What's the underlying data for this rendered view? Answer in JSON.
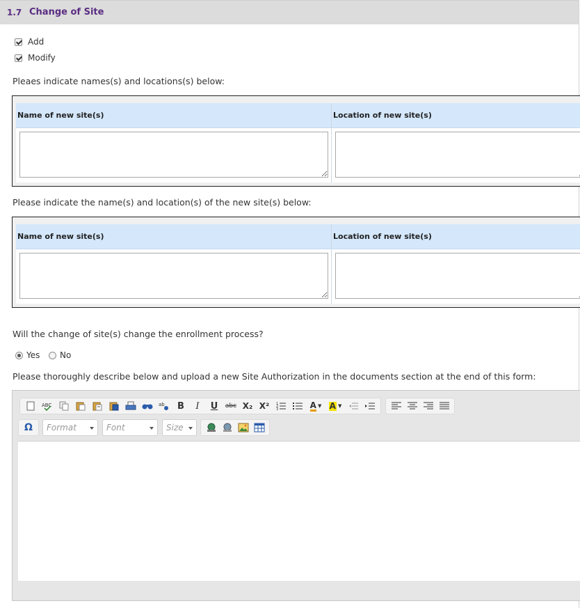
{
  "section": {
    "number": "1.7",
    "title": "Change of Site"
  },
  "checkboxes": [
    {
      "label": "Add",
      "checked": true
    },
    {
      "label": "Modify",
      "checked": true
    }
  ],
  "prompts": {
    "names_locations": "Pleaes indicate names(s) and locations(s) below:",
    "new_sites": "Please indicate the name(s) and location(s) of the new site(s) below:",
    "enrollment": "Will the change of site(s) change the enrollment process?",
    "describe": "Please thoroughly describe below and upload a new Site Authorization in the documents section at the end of this form:"
  },
  "table1": {
    "col1": "Name of new site(s)",
    "col2": "Location of new site(s)"
  },
  "table2": {
    "col1": "Name of new site(s)",
    "col2": "Location of new site(s)"
  },
  "enrollment_radio": {
    "yes": "Yes",
    "no": "No",
    "selected": "Yes"
  },
  "editor": {
    "combos": {
      "format": "Format",
      "font": "Font",
      "size": "Size"
    },
    "buttons": {
      "bold": "B",
      "italic": "I",
      "underline": "U",
      "strike": "abc",
      "subscript": "X₂",
      "superscript": "X²",
      "omega": "Ω",
      "text_color": "A",
      "bg_color": "A"
    },
    "colors": {
      "bg_highlight": "#f2e200",
      "text_color_bar": "#e69b00"
    }
  }
}
